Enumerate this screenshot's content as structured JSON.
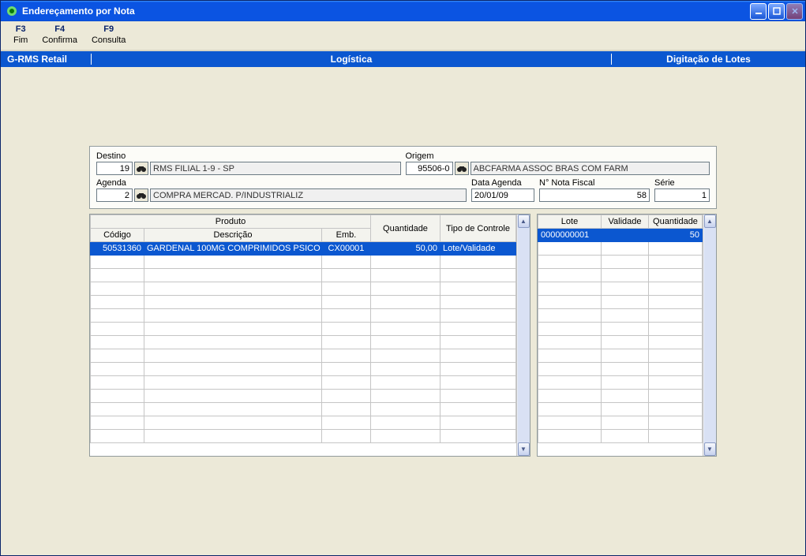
{
  "window": {
    "title": "Endereçamento por Nota"
  },
  "menu": {
    "items": [
      {
        "fkey": "F3",
        "label": "Fim"
      },
      {
        "fkey": "F4",
        "label": "Confirma"
      },
      {
        "fkey": "F9",
        "label": "Consulta"
      }
    ]
  },
  "banner": {
    "left": "G-RMS Retail",
    "center": "Logística",
    "right": "Digitação de Lotes"
  },
  "filters": {
    "destino_label": "Destino",
    "destino_code": "19",
    "destino_desc": "RMS FILIAL 1-9 - SP",
    "origem_label": "Origem",
    "origem_code": "95506-0",
    "origem_desc": "ABCFARMA ASSOC BRAS COM FARM",
    "agenda_label": "Agenda",
    "agenda_code": "2",
    "agenda_desc": "COMPRA MERCAD. P/INDUSTRIALIZ",
    "data_agenda_label": "Data Agenda",
    "data_agenda": "20/01/09",
    "nota_label": "N° Nota Fiscal",
    "nota": "58",
    "serie_label": "Série",
    "serie": "1"
  },
  "grid_left": {
    "headers": {
      "produto": "Produto",
      "codigo": "Código",
      "descricao": "Descrição",
      "emb": "Emb.",
      "quantidade": "Quantidade",
      "tipo": "Tipo de Controle"
    },
    "rows": [
      {
        "codigo": "50531360",
        "descricao": "GARDENAL 100MG COMPRIMIDOS PSICO",
        "emb": "CX00001",
        "quantidade": "50,00",
        "tipo": "Lote/Validade"
      }
    ]
  },
  "grid_right": {
    "headers": {
      "lote": "Lote",
      "validade": "Validade",
      "quantidade": "Quantidade"
    },
    "rows": [
      {
        "lote": "0000000001",
        "validade": "",
        "quantidade": "50"
      }
    ]
  }
}
